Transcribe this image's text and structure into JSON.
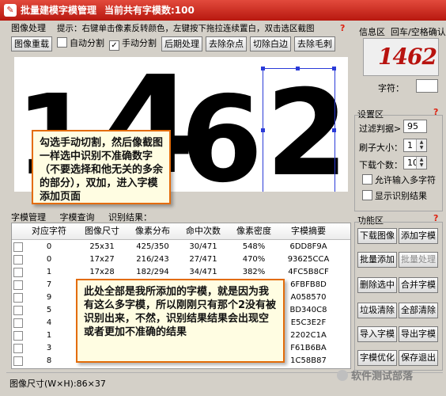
{
  "window": {
    "title": "批量建模字模管理",
    "subtitle": "当前共有字模数:100"
  },
  "left_panel": {
    "section_label": "图像处理",
    "hint": "提示：右键单击像素反转颜色，左键按下拖拉连续置白，双击选区截图",
    "help": "?"
  },
  "toolbar": {
    "reset_image": "图像重载",
    "auto_split": "自动分割",
    "manual_split": "手动分割",
    "post_process": "后期处理",
    "remove_noise": "去除杂点",
    "cut_white_edge": "切除白边",
    "remove_burrs": "去除毛刺",
    "auto_split_checked": false,
    "manual_split_checked": true
  },
  "canvas": {
    "digits": [
      "1",
      "4",
      "6",
      "2"
    ]
  },
  "callout_top": {
    "text": "勾选手动切割，然后像截图一样选中识别不准确数字（不要选择和他无关的多余的部分），双加，进入字模添加页面"
  },
  "tabs": [
    "字模管理",
    "字模查询",
    "识别结果："
  ],
  "table": {
    "headers": [
      "对应字符",
      "图像尺寸",
      "像素分布",
      "命中次数",
      "像素密度",
      "字模摘要"
    ],
    "rows": [
      {
        "char": "0",
        "size": "25x31",
        "dist": "425/350",
        "hits": "30/471",
        "density": "548%",
        "digest": "6DD8F9A"
      },
      {
        "char": "0",
        "size": "17x27",
        "dist": "216/243",
        "hits": "27/471",
        "density": "470%",
        "digest": "93625CCA"
      },
      {
        "char": "1",
        "size": "17x28",
        "dist": "182/294",
        "hits": "34/471",
        "density": "382%",
        "digest": "4FC5B8CF"
      },
      {
        "char": "7",
        "size": "",
        "dist": "",
        "hits": "",
        "density": "",
        "digest": "6FBFB8D"
      },
      {
        "char": "9",
        "size": "",
        "dist": "",
        "hits": "",
        "density": "",
        "digest": "A058570"
      },
      {
        "char": "5",
        "size": "",
        "dist": "",
        "hits": "",
        "density": "",
        "digest": "BD340C8"
      },
      {
        "char": "4",
        "size": "",
        "dist": "",
        "hits": "",
        "density": "",
        "digest": "E5C3E2F"
      },
      {
        "char": "1",
        "size": "",
        "dist": "",
        "hits": "",
        "density": "",
        "digest": "2202C1A"
      },
      {
        "char": "3",
        "size": "",
        "dist": "",
        "hits": "",
        "density": "",
        "digest": "F61B6BA"
      },
      {
        "char": "8",
        "size": "",
        "dist": "",
        "hits": "",
        "density": "",
        "digest": "1C58B87"
      }
    ]
  },
  "callout_bottom": {
    "text": "此处全部是我所添加的字模，就是因为我有这么多字模，所以刚刚只有那个2没有被识别出来，不然，识别结果结果会出现空或者更加不准确的结果"
  },
  "status": {
    "image_size": "图像尺寸(W×H):86×37"
  },
  "watermark": "软件测试部落",
  "info_panel": {
    "title": "信息区",
    "confirm_hint": "回车/空格确认",
    "char_label": "字符：",
    "preview_text": "1462"
  },
  "settings": {
    "title": "设置区",
    "help": "?",
    "threshold_label": "过滤判据>",
    "threshold_value": "95",
    "brush_label": "刷子大小：",
    "brush_value": "1",
    "download_label": "下载个数：",
    "download_value": "10",
    "allow_multi": "允许输入多字符",
    "show_result": "显示识别结果",
    "allow_multi_checked": false,
    "show_result_checked": false
  },
  "functions": {
    "title": "功能区",
    "help": "?",
    "download_image": "下载图像",
    "add_glyph": "添加字模",
    "batch_add": "批量添加",
    "batch_process": "批量处理",
    "delete_selected": "删除选中",
    "merge_glyph": "合并字模",
    "clear_junk": "垃圾清除",
    "clear_all": "全部清除",
    "import_glyph": "导入字模",
    "export_glyph": "导出字模",
    "optimize_glyph": "字模优化",
    "save_exit": "保存退出"
  }
}
